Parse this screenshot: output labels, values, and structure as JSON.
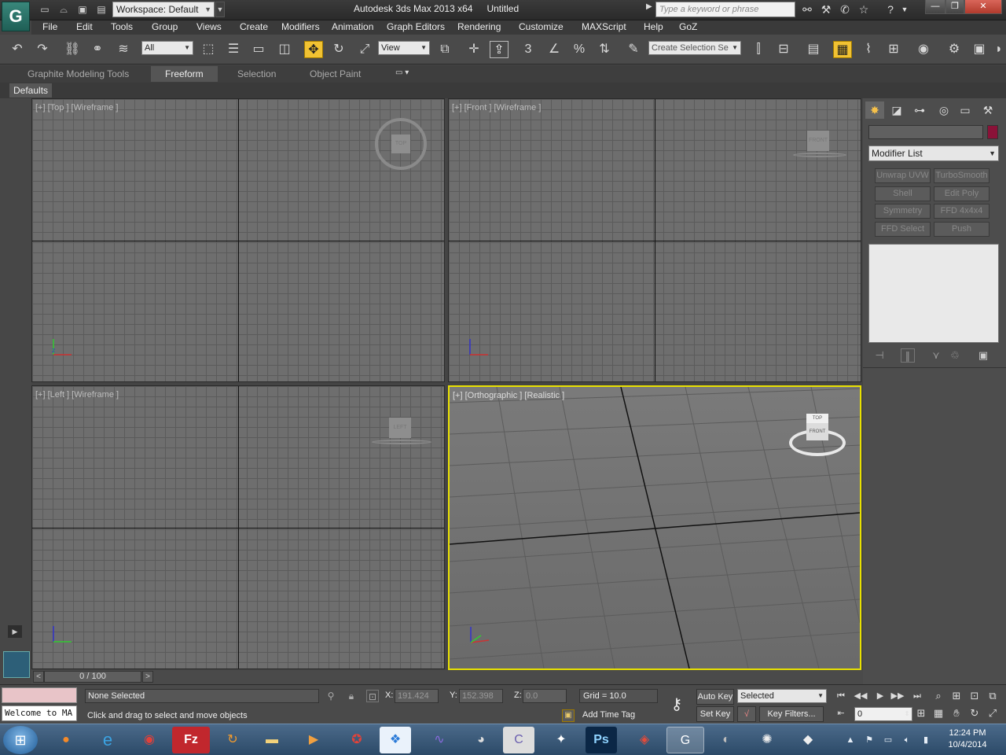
{
  "window": {
    "app_name": "Autodesk 3ds Max  2013 x64",
    "doc_name": "Untitled",
    "workspace": "Workspace: Default",
    "search_placeholder": "Type a keyword or phrase"
  },
  "menu": [
    "File",
    "Edit",
    "Tools",
    "Group",
    "Views",
    "Create",
    "Modifiers",
    "Animation",
    "Graph Editors",
    "Rendering",
    "Customize",
    "MAXScript",
    "Help",
    "GoZ"
  ],
  "toolbar": {
    "selection_filter": "All",
    "ref_coord": "View",
    "named_selection_placeholder": "Create Selection Se",
    "snap_label": "3"
  },
  "ribbon": {
    "tabs": [
      "Graphite Modeling Tools",
      "Freeform",
      "Selection",
      "Object Paint"
    ],
    "active_tab": "Freeform",
    "defaults": "Defaults"
  },
  "viewports": {
    "top": {
      "label": "[+] [Top ] [Wireframe ]",
      "cube": "TOP"
    },
    "front": {
      "label": "[+] [Front ] [Wireframe ]",
      "cube": "FRONT"
    },
    "left": {
      "label": "[+] [Left ] [Wireframe ]",
      "cube": "LEFT"
    },
    "persp": {
      "label": "[+] [Orthographic ] [Realistic ]",
      "cube_top": "TOP",
      "cube_front": "FRONT"
    }
  },
  "command_panel": {
    "modifier_list": "Modifier List",
    "modifier_buttons": [
      "Unwrap UVW",
      "TurboSmooth",
      "Shell",
      "Edit Poly",
      "Symmetry",
      "FFD 4x4x4",
      "FFD Select",
      "Push"
    ],
    "object_color": "#8a1238"
  },
  "timeline": {
    "slider": "0 / 100"
  },
  "status": {
    "listener_text": "Welcome to MA",
    "selection": "None Selected",
    "prompt": "Click and drag to select and move objects",
    "x_label": "X:",
    "x": "191.424",
    "y_label": "Y:",
    "y": "152.398",
    "z_label": "Z:",
    "z": "0.0",
    "grid": "Grid = 10.0",
    "add_time_tag": "Add Time Tag",
    "auto_key": "Auto Key",
    "set_key": "Set Key",
    "selected": "Selected",
    "key_filters": "Key Filters...",
    "frame": "0"
  },
  "taskbar": {
    "time": "12:24 PM",
    "date": "10/4/2014"
  },
  "colors": {
    "active_viewport_border": "#e8e000",
    "active_tool": "#f1c232"
  }
}
